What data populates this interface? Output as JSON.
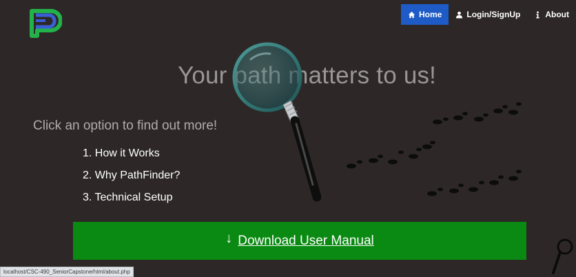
{
  "nav": {
    "items": [
      {
        "icon": "home-icon",
        "label": "Home",
        "active": true
      },
      {
        "icon": "user-icon",
        "label": "Login/SignUp",
        "active": false
      },
      {
        "icon": "info-icon",
        "label": "About",
        "active": false
      }
    ]
  },
  "hero": {
    "headline": "Your path matters to us!",
    "subhead": "Click an option to find out more!"
  },
  "options": [
    "1. How it Works",
    "2. Why PathFinder?",
    "3. Technical Setup"
  ],
  "download": {
    "icon": "down-arrow-icon",
    "icon_glyph": "↓",
    "label": "Download User Manual"
  },
  "status_bar": {
    "url": "localhost/CSC-490_SeniorCapstone/html/about.php"
  },
  "colors": {
    "background": "#2d2827",
    "nav_active": "#1e5bc6",
    "download_button": "#0a8a12",
    "headline_text": "#9a9693"
  }
}
